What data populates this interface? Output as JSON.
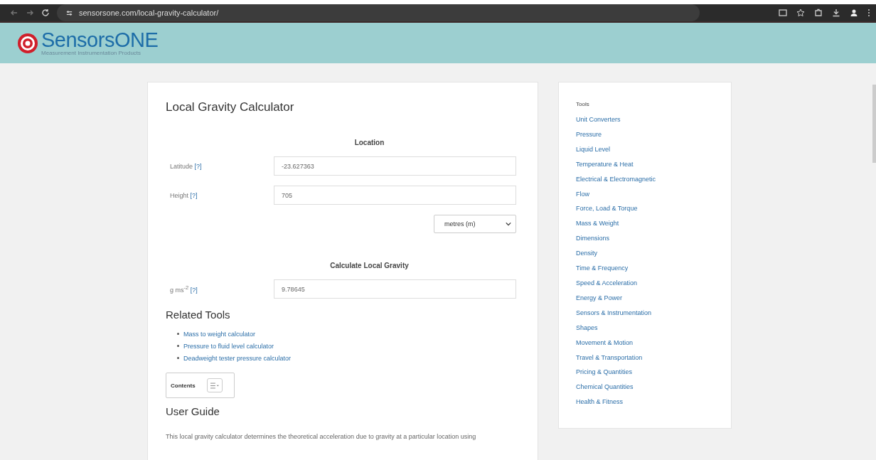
{
  "browser": {
    "url": "sensorsone.com/local-gravity-calculator/"
  },
  "header": {
    "logo": "SensorsONE",
    "tagline": "Measurement Instrumentation Products"
  },
  "calculator": {
    "title": "Local Gravity Calculator",
    "sections": [
      {
        "heading": "Location",
        "fields": [
          {
            "kind": "input",
            "label": "Latitude",
            "help": "[?]",
            "value": "-23.627363"
          },
          {
            "kind": "input",
            "label": "Height",
            "help": "[?]",
            "value": "705"
          },
          {
            "kind": "select",
            "value": "metres (m)"
          }
        ]
      },
      {
        "heading": "Calculate Local Gravity",
        "fields": [
          {
            "kind": "input",
            "label": "g ms$^{-2}$",
            "help": "[?]",
            "value": "9.78645"
          }
        ]
      }
    ]
  },
  "related_tools": {
    "heading": "Related Tools",
    "links": [
      "Mass to weight calculator",
      "Pressure to fluid level calculator",
      "Deadweight tester pressure calculator"
    ]
  },
  "contents": {
    "label": "Contents"
  },
  "user_guide": {
    "heading": "User Guide",
    "text": "This local gravity calculator determines the theoretical acceleration due to gravity at a particular location using"
  },
  "sidebar": {
    "heading": "Tools",
    "items": [
      "Unit Converters",
      "Pressure",
      "Liquid Level",
      "Temperature & Heat",
      "Electrical & Electromagnetic",
      "Flow",
      "Force, Load & Torque",
      "Mass & Weight",
      "Dimensions",
      "Density",
      "Time & Frequency",
      "Speed & Acceleration",
      "Energy & Power",
      "Sensors & Instrumentation",
      "Shapes",
      "Movement & Motion",
      "Travel & Transportation",
      "Pricing & Quantities",
      "Chemical Quantities",
      "Health & Fitness"
    ]
  }
}
